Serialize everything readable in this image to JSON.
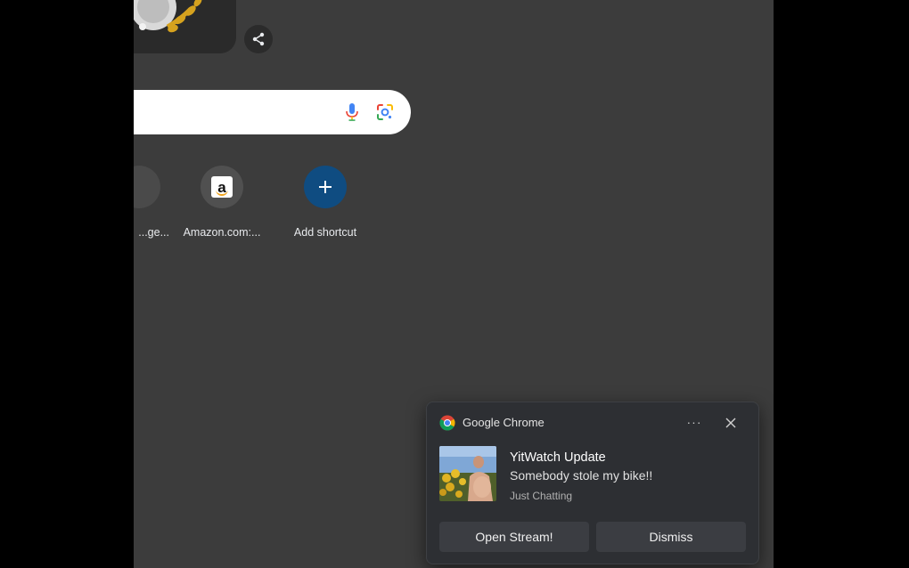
{
  "search": {
    "value": "",
    "placeholder": ""
  },
  "shortcuts": [
    {
      "label": "...ge...",
      "icon": "partial-shortcut-icon"
    },
    {
      "label": "Amazon.com:...",
      "icon": "amazon-icon"
    },
    {
      "label": "Add shortcut",
      "icon": "plus-icon"
    }
  ],
  "notification": {
    "app_name": "Google Chrome",
    "more_label": "···",
    "title": "YitWatch Update",
    "message": "Somebody stole my bike!!",
    "attribution": "Just Chatting",
    "actions": [
      {
        "label": "Open Stream!"
      },
      {
        "label": "Dismiss"
      }
    ]
  },
  "colors": {
    "page_background": "#3c3c3c",
    "letterbox": "#000000",
    "toast_background": "#2d2f33",
    "add_shortcut": "#0f4c81"
  }
}
